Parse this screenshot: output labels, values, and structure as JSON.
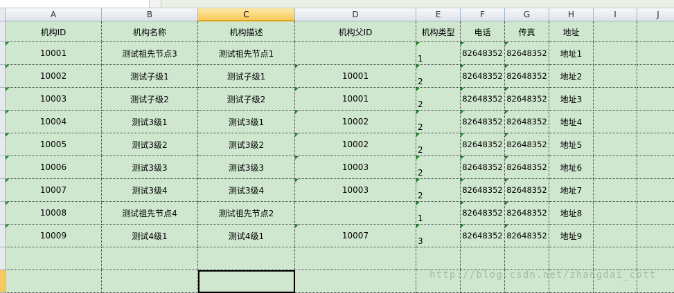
{
  "columns": [
    "A",
    "B",
    "C",
    "D",
    "E",
    "F",
    "G",
    "H",
    "I",
    "J"
  ],
  "active_column": "C",
  "header_row": [
    "机构ID",
    "机构名称",
    "机构描述",
    "机构父ID",
    "机构类型",
    "电话",
    "传真",
    "地址",
    "",
    ""
  ],
  "rows": [
    [
      "10001",
      "测试祖先节点3",
      "测试祖先节点1",
      "",
      "1",
      "82648352",
      "82648352",
      "地址1"
    ],
    [
      "10002",
      "测试子级1",
      "测试子级1",
      "10001",
      "2",
      "82648352",
      "82648352",
      "地址2"
    ],
    [
      "10003",
      "测试子级2",
      "测试子级2",
      "10001",
      "2",
      "82648352",
      "82648352",
      "地址3"
    ],
    [
      "10004",
      "测试3级1",
      "测试3级1",
      "10002",
      "2",
      "82648352",
      "82648352",
      "地址4"
    ],
    [
      "10005",
      "测试3级2",
      "测试3级2",
      "10002",
      "2",
      "82648352",
      "82648352",
      "地址5"
    ],
    [
      "10006",
      "测试3级3",
      "测试3级3",
      "10003",
      "2",
      "82648352",
      "82648352",
      "地址6"
    ],
    [
      "10007",
      "测试3级4",
      "测试3级4",
      "10003",
      "2",
      "82648352",
      "82648352",
      "地址7"
    ],
    [
      "10008",
      "测试祖先节点4",
      "测试祖先节点2",
      "",
      "1",
      "82648352",
      "82648352",
      "地址8"
    ],
    [
      "10009",
      "测试4级1",
      "测试4级1",
      "10007",
      "3",
      "82648352",
      "82648352",
      "地址9"
    ]
  ],
  "watermark": "http://blog.csdn.net/zhangdai_cott",
  "colors": {
    "cell_fill": "#cfe7cf",
    "header_fill": "#dfe3e8",
    "active_header": "#f7c85d",
    "text_marker": "#1a8b25"
  }
}
